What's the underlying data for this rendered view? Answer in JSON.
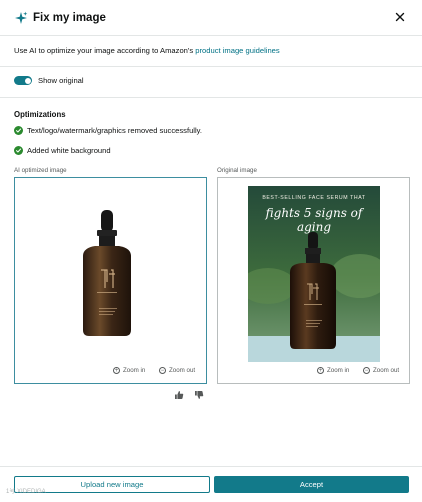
{
  "header": {
    "title": "Fix my image",
    "sparkle_icon": "sparkle-icon",
    "close_icon": "close-icon"
  },
  "intro": {
    "text": "Use AI to optimize your image according to Amazon's ",
    "link": "product image guidelines"
  },
  "toggle": {
    "label": "Show original",
    "on": true
  },
  "optimizations": {
    "title": "Optimizations",
    "items": [
      {
        "text": "Text/logo/watermark/graphics removed successfully."
      },
      {
        "text": "Added white background"
      }
    ]
  },
  "ai_image": {
    "label": "AI optimized image",
    "zoom_in": "Zoom in",
    "zoom_out": "Zoom out"
  },
  "original_image": {
    "label": "Original image",
    "headline_top": "BEST-SELLING FACE SERUM THAT",
    "headline_main": "fights 5 signs of aging",
    "zoom_in": "Zoom in",
    "zoom_out": "Zoom out"
  },
  "feedback": {
    "thumbs_up": "thumbs-up-icon",
    "thumbs_down": "thumbs-down-icon"
  },
  "footer": {
    "upload_label": "Upload new image",
    "accept_label": "Accept"
  },
  "watermark": "1号 XIDEDIGA",
  "colors": {
    "accent": "#127a8a",
    "success": "#2b8a2f",
    "link": "#007185"
  }
}
